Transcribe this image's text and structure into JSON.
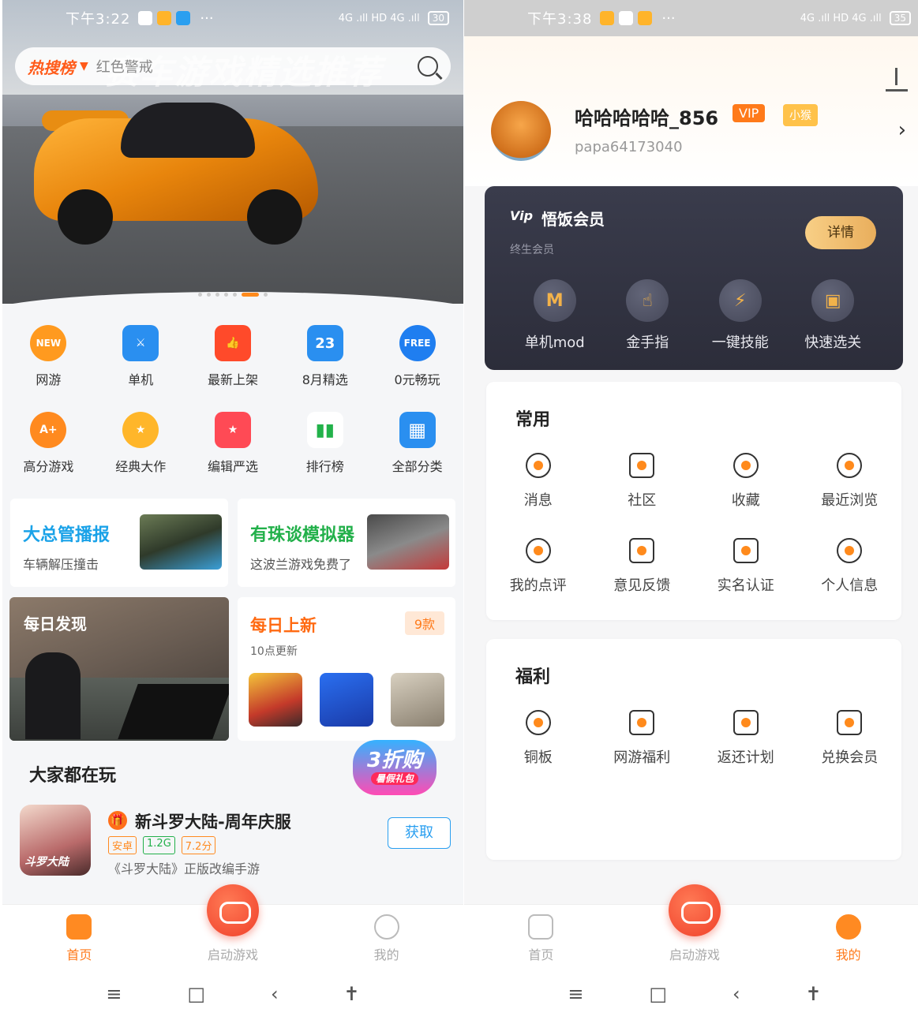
{
  "left": {
    "status": {
      "time": "下午3:22",
      "signal": "4G .ıll HD 4G .ıll",
      "battery": "30"
    },
    "hero_overlay_text": "赛车游戏精选推荐",
    "search": {
      "tag": "热搜榜",
      "placeholder": "红色警戒"
    },
    "categories_row1": [
      {
        "label": "网游",
        "icon": "new-badge-icon",
        "glyph": "NEW",
        "color": "#ff9a1f"
      },
      {
        "label": "单机",
        "icon": "sword-icon",
        "glyph": "⚔",
        "color": "#2a8ff0"
      },
      {
        "label": "最新上架",
        "icon": "thumbs-up-icon",
        "glyph": "👍",
        "color": "#ff4a2a"
      },
      {
        "label": "8月精选",
        "icon": "calendar-icon",
        "glyph": "23",
        "color": "#2a8ff0"
      },
      {
        "label": "0元畅玩",
        "icon": "free-icon",
        "glyph": "FREE",
        "color": "#1f7ef0"
      }
    ],
    "categories_row2": [
      {
        "label": "高分游戏",
        "icon": "high-score-icon",
        "glyph": "A+",
        "color": "#ff8a1f"
      },
      {
        "label": "经典大作",
        "icon": "medal-icon",
        "glyph": "★",
        "color": "#ffb62a"
      },
      {
        "label": "编辑严选",
        "icon": "basket-icon",
        "glyph": "★",
        "color": "#ff4a55"
      },
      {
        "label": "排行榜",
        "icon": "bar-chart-icon",
        "glyph": "▮▮",
        "color": "#22b24a"
      },
      {
        "label": "全部分类",
        "icon": "grid-icon",
        "glyph": "▦",
        "color": "#2a8ff0"
      }
    ],
    "promo1": {
      "title": "大总管播报",
      "sub": "车辆解压撞击",
      "title_color": "#1aa2e8"
    },
    "promo2": {
      "title": "有珠谈模拟器",
      "sub": "这波兰游戏免费了",
      "title_color": "#22b04a"
    },
    "daily": {
      "title": "每日发现"
    },
    "new_daily": {
      "title": "每日上新",
      "badge": "9款",
      "sub": "10点更新"
    },
    "section_title": "大家都在玩",
    "sale_badge": {
      "big": "3折购",
      "small": "暑假礼包"
    },
    "game": {
      "name": "新斗罗大陆-周年庆服",
      "thumb_text": "斗罗大陆",
      "tags": [
        {
          "text": "安卓",
          "color": "#ff8a1f"
        },
        {
          "text": "1.2G",
          "color": "#22b04a"
        },
        {
          "text": "7.2分",
          "color": "#ff8a1f"
        }
      ],
      "desc": "《斗罗大陆》正版改编手游",
      "button": "获取"
    },
    "tabs": [
      {
        "label": "首页",
        "active": true
      },
      {
        "label": "启动游戏",
        "active": false
      },
      {
        "label": "我的",
        "active": false
      }
    ],
    "nav": [
      "≡",
      "□",
      "‹",
      "✝"
    ]
  },
  "right": {
    "status": {
      "time": "下午3:38",
      "signal": "4G .ıll HD 4G .ıll",
      "battery": "35"
    },
    "user": {
      "name": "哈哈哈哈哈_856",
      "vip": "VIP",
      "level": "小猴",
      "id": "papa64173040"
    },
    "vip_card": {
      "logo": "Vip",
      "title": "悟饭会员",
      "sub": "终生会员",
      "button": "详情",
      "features": [
        {
          "label": "单机mod",
          "icon": "mod-icon",
          "glyph": "M"
        },
        {
          "label": "金手指",
          "icon": "cheat-finger-icon",
          "glyph": "☝"
        },
        {
          "label": "一键技能",
          "icon": "lightning-icon",
          "glyph": "⚡"
        },
        {
          "label": "快速选关",
          "icon": "level-select-icon",
          "glyph": "▣"
        }
      ]
    },
    "common": {
      "title": "常用",
      "row1": [
        {
          "label": "消息",
          "icon": "message-icon"
        },
        {
          "label": "社区",
          "icon": "community-icon"
        },
        {
          "label": "收藏",
          "icon": "star-icon"
        },
        {
          "label": "最近浏览",
          "icon": "history-icon"
        }
      ],
      "row2": [
        {
          "label": "我的点评",
          "icon": "review-icon"
        },
        {
          "label": "意见反馈",
          "icon": "feedback-icon"
        },
        {
          "label": "实名认证",
          "icon": "id-card-icon"
        },
        {
          "label": "个人信息",
          "icon": "profile-icon"
        }
      ]
    },
    "welfare": {
      "title": "福利",
      "row": [
        {
          "label": "铜板",
          "icon": "coin-icon"
        },
        {
          "label": "网游福利",
          "icon": "crown-icon"
        },
        {
          "label": "返还计划",
          "icon": "refund-icon"
        },
        {
          "label": "兑换会员",
          "icon": "vip-bag-icon"
        }
      ]
    },
    "tabs": [
      {
        "label": "首页",
        "active": false
      },
      {
        "label": "启动游戏",
        "active": false
      },
      {
        "label": "我的",
        "active": true
      }
    ],
    "nav": [
      "≡",
      "□",
      "‹",
      "✝"
    ]
  }
}
